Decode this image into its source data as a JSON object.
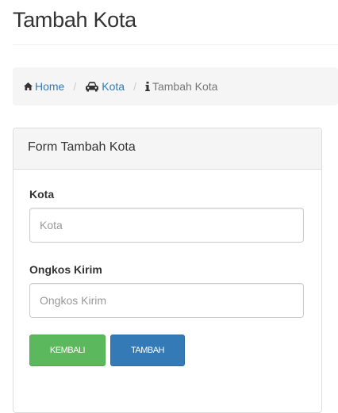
{
  "page": {
    "title": "Tambah Kota"
  },
  "breadcrumb": {
    "items": [
      {
        "label": "Home",
        "icon": "home-icon"
      },
      {
        "label": "Kota",
        "icon": "car-icon"
      },
      {
        "label": "Tambah Kota",
        "icon": "info-icon"
      }
    ],
    "separator": "/"
  },
  "form": {
    "panel_title": "Form Tambah Kota",
    "fields": [
      {
        "label": "Kota",
        "placeholder": "Kota",
        "value": ""
      },
      {
        "label": "Ongkos Kirim",
        "placeholder": "Ongkos Kirim",
        "value": ""
      }
    ],
    "buttons": {
      "back_label": "KEMBALI",
      "submit_label": "TAMBAH"
    }
  },
  "colors": {
    "link": "#337ab7",
    "success": "#5cb85c",
    "primary": "#337ab7",
    "breadcrumb_bg": "#f5f5f5"
  }
}
